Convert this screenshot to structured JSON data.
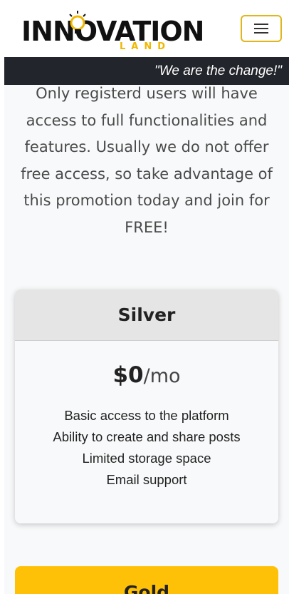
{
  "header": {
    "logo": {
      "wordmark": "INNOVATION",
      "sub": "LAND",
      "icon": "lightbulb-icon",
      "accent_color": "#f0b800"
    },
    "menu_toggle_icon": "hamburger-icon",
    "tagline": "\"We are the change!\""
  },
  "intro": {
    "text": "Only registerd users will have access to full functionalities and features. Usually we do not offer free access, so take advantage of this promotion today and join for FREE!"
  },
  "plans": [
    {
      "name": "Silver",
      "price": "$0",
      "period": "/mo",
      "features": [
        "Basic access to the platform",
        "Ability to create and share posts",
        "Limited storage space",
        "Email support"
      ],
      "header_color": "#e5e5e5"
    },
    {
      "name": "Gold",
      "header_color": "#ffc107"
    }
  ]
}
